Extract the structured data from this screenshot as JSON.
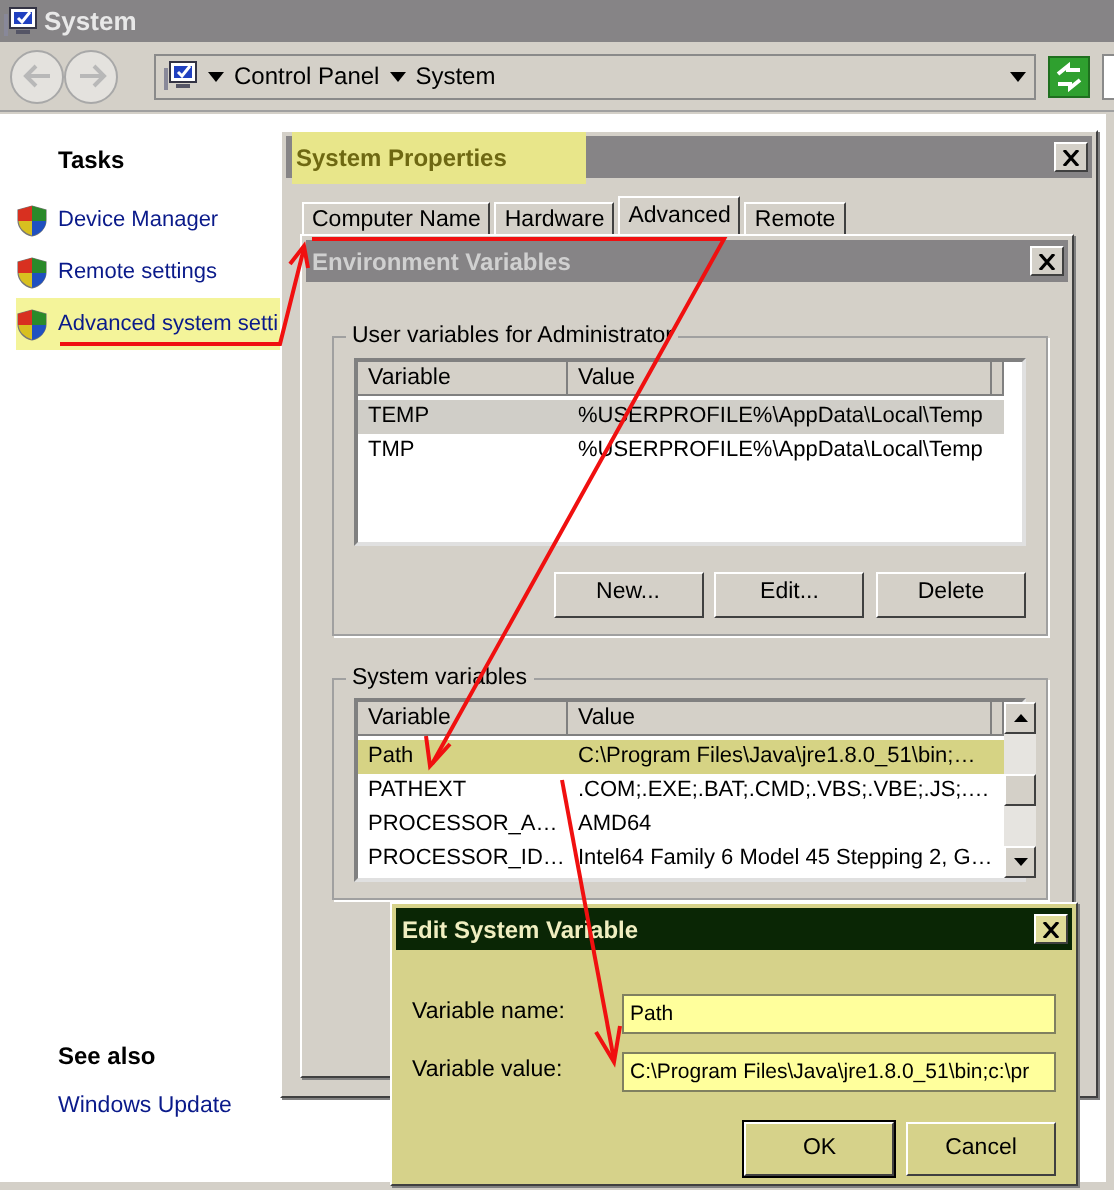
{
  "window": {
    "title": "System"
  },
  "address_bar": {
    "crumbs": [
      "Control Panel",
      "System"
    ]
  },
  "tasks": {
    "heading": "Tasks",
    "items": [
      {
        "label": "Device Manager",
        "highlighted": false
      },
      {
        "label": "Remote settings",
        "highlighted": false
      },
      {
        "label": "Advanced system setti",
        "highlighted": true
      }
    ]
  },
  "see_also": {
    "heading": "See also",
    "items": [
      "Windows Update"
    ]
  },
  "system_properties": {
    "title": "System Properties",
    "title_highlighted": true,
    "tabs": [
      {
        "label": "Computer Name",
        "selected": false
      },
      {
        "label": "Hardware",
        "selected": false
      },
      {
        "label": "Advanced",
        "selected": true
      },
      {
        "label": "Remote",
        "selected": false
      }
    ]
  },
  "environment_variables": {
    "title": "Environment Variables",
    "user_variables": {
      "label": "User variables for Administrator",
      "columns": [
        "Variable",
        "Value"
      ],
      "rows": [
        {
          "variable": "TEMP",
          "value": "%USERPROFILE%\\AppData\\Local\\Temp",
          "selected": true
        },
        {
          "variable": "TMP",
          "value": "%USERPROFILE%\\AppData\\Local\\Temp",
          "selected": false
        }
      ],
      "buttons": [
        "New...",
        "Edit...",
        "Delete"
      ]
    },
    "system_variables": {
      "label": "System variables",
      "columns": [
        "Variable",
        "Value"
      ],
      "rows": [
        {
          "variable": "Path",
          "value": "C:\\Program Files\\Java\\jre1.8.0_51\\bin;…",
          "selected": true
        },
        {
          "variable": "PATHEXT",
          "value": ".COM;.EXE;.BAT;.CMD;.VBS;.VBE;.JS;.…",
          "selected": false
        },
        {
          "variable": "PROCESSOR_A…",
          "value": "AMD64",
          "selected": false
        },
        {
          "variable": "PROCESSOR_ID…",
          "value": "Intel64 Family 6 Model 45 Stepping 2, G…",
          "selected": false
        }
      ]
    }
  },
  "edit_dialog": {
    "title": "Edit System Variable",
    "fields": [
      {
        "label": "Variable name:",
        "value": "Path"
      },
      {
        "label": "Variable value:",
        "value": "C:\\Program Files\\Java\\jre1.8.0_51\\bin;c:\\pr"
      }
    ],
    "buttons": [
      {
        "label": "OK",
        "default": true
      },
      {
        "label": "Cancel",
        "default": false
      }
    ]
  }
}
